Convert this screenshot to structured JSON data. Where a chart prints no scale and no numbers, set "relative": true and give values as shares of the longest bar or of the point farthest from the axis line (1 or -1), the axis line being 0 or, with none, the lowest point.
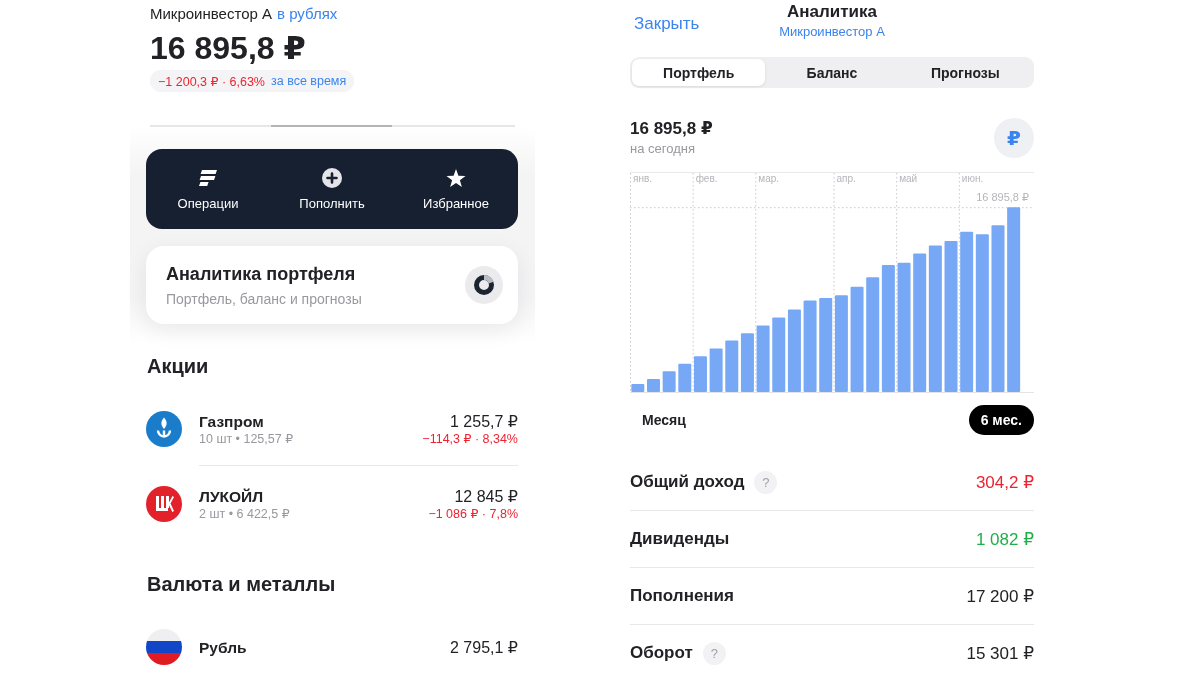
{
  "portfolio": {
    "name": "Микроинвестор А",
    "currency_link": "в рублях",
    "total": "16 895,8 ₽",
    "change": "−1 200,3 ₽ · 6,63%",
    "change_period": "за все время"
  },
  "actions": [
    {
      "label": "Операции"
    },
    {
      "label": "Пополнить"
    },
    {
      "label": "Избранное"
    }
  ],
  "analytics_card": {
    "title": "Аналитика портфеля",
    "subtitle": "Портфель, баланс и прогнозы"
  },
  "sections": [
    {
      "title": "Акции",
      "items": [
        {
          "name": "Газпром",
          "details": "10 шт • 125,57 ₽",
          "value": "1 255,7 ₽",
          "change": "−114,3 ₽ · 8,34%"
        },
        {
          "name": "ЛУКОЙЛ",
          "details": "2 шт • 6 422,5 ₽",
          "value": "12 845 ₽",
          "change": "−1 086 ₽ · 7,8%"
        }
      ]
    },
    {
      "title": "Валюта и металлы",
      "items": [
        {
          "name": "Рубль",
          "value": "2 795,1 ₽"
        }
      ]
    }
  ],
  "analytics": {
    "close": "Закрыть",
    "title": "Аналитика",
    "subtitle": "Микроинвестор А",
    "tabs": [
      {
        "label": "Портфель",
        "selected": true
      },
      {
        "label": "Баланс",
        "selected": false
      },
      {
        "label": "Прогнозы",
        "selected": false
      }
    ],
    "total": "16 895,8 ₽",
    "total_caption": "на сегодня",
    "currency_button": "₽",
    "chart_data": {
      "type": "bar",
      "relative": true,
      "grid": true,
      "categories": [
        "янв.",
        null,
        null,
        null,
        "фев.",
        null,
        null,
        null,
        "мар.",
        null,
        null,
        null,
        null,
        "апр.",
        null,
        null,
        null,
        "май",
        null,
        null,
        null,
        "июн.",
        null,
        null,
        null
      ],
      "series": [
        {
          "color": "#77a8f6",
          "values": [
            0.043,
            0.07,
            0.112,
            0.153,
            0.194,
            0.236,
            0.279,
            0.318,
            0.36,
            0.403,
            0.446,
            0.495,
            0.509,
            0.523,
            0.57,
            0.621,
            0.687,
            0.7,
            0.75,
            0.793,
            0.817,
            0.867,
            0.853,
            0.903,
            1.0
          ]
        }
      ],
      "annotations": [
        {
          "y": 1.0,
          "text": "16 895,8 ₽"
        }
      ]
    },
    "periods": [
      {
        "label": "Месяц",
        "selected": false
      },
      {
        "label": "6 мес.",
        "selected": true
      }
    ],
    "stats": [
      {
        "label": "Общий доход",
        "hint": "?",
        "value": "304,2 ₽",
        "color": "#ee2330"
      },
      {
        "label": "Дивиденды",
        "value": "1 082 ₽",
        "color": "#1fae4a"
      },
      {
        "label": "Пополнения",
        "value": "17 200 ₽",
        "color": "#222226"
      },
      {
        "label": "Оборот",
        "hint": "?",
        "value": "15 301 ₽",
        "color": "#222226"
      }
    ]
  }
}
